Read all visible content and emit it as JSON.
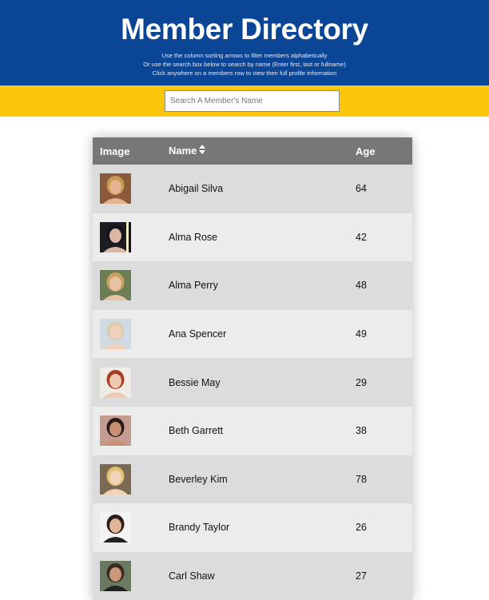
{
  "header": {
    "title": "Member Directory",
    "instructions": [
      "Use the column sorting arrows to filter members alphabetically",
      "Or use the search box below to search by name (Enter first, last or fullname)",
      "Click anywhere on a members row to view their full profile information"
    ]
  },
  "search": {
    "placeholder": "Search A Member's Name",
    "value": ""
  },
  "table": {
    "headers": {
      "image": "Image",
      "name": "Name",
      "age": "Age"
    },
    "rows": [
      {
        "name": "Abigail Silva",
        "age": "64",
        "avatar": "woman-portrait"
      },
      {
        "name": "Alma Rose",
        "age": "42",
        "avatar": "woman-portrait"
      },
      {
        "name": "Alma Perry",
        "age": "48",
        "avatar": "woman-portrait"
      },
      {
        "name": "Ana Spencer",
        "age": "49",
        "avatar": "woman-portrait"
      },
      {
        "name": "Bessie May",
        "age": "29",
        "avatar": "woman-portrait"
      },
      {
        "name": "Beth Garrett",
        "age": "38",
        "avatar": "woman-portrait"
      },
      {
        "name": "Beverley Kim",
        "age": "78",
        "avatar": "woman-portrait"
      },
      {
        "name": "Brandy Taylor",
        "age": "26",
        "avatar": "woman-portrait"
      },
      {
        "name": "Carl Shaw",
        "age": "27",
        "avatar": "man-portrait"
      }
    ]
  },
  "colors": {
    "header_bg": "#0b4596",
    "search_bar_bg": "#fcc70b",
    "table_header_bg": "#777777",
    "row_odd_bg": "#dcdcdc",
    "row_even_bg": "#ececec"
  }
}
